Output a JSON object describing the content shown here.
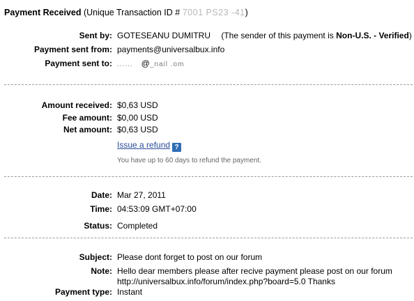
{
  "header": {
    "title": "Payment Received",
    "transaction_prefix": "(Unique Transaction ID #",
    "transaction_id_obscured": "   7001 PS23 -41",
    "transaction_suffix": ")"
  },
  "sender": {
    "sent_by_label": "Sent by:",
    "sent_by_name": "GOTESEANU DUMITRU",
    "sender_status_prefix": "(The sender of this payment is",
    "sender_status_value": "Non-U.S. - Verified",
    "sender_status_suffix": ")",
    "from_label": "Payment sent from:",
    "from_email": "payments@universalbux.info",
    "to_label": "Payment sent to:",
    "to_email_part1": "......",
    "to_email_at": "@",
    "to_email_part2": "_nail .om"
  },
  "amounts": {
    "received_label": "Amount received:",
    "received_value": "$0,63 USD",
    "fee_label": "Fee amount:",
    "fee_value": "$0,00 USD",
    "net_label": "Net amount:",
    "net_value": "$0,63 USD",
    "refund_link": "Issue a refund",
    "help_icon_glyph": "?",
    "refund_note": "You have up to 60 days to refund the payment."
  },
  "details": {
    "date_label": "Date:",
    "date_value": "Mar 27, 2011",
    "time_label": "Time:",
    "time_value": "04:53:09 GMT+07:00",
    "status_label": "Status:",
    "status_value": "Completed"
  },
  "message": {
    "subject_label": "Subject:",
    "subject_value": "Please dont forget to post on our forum",
    "note_label": "Note:",
    "note_line1": "Hello dear members please after recive payment please post on our forum",
    "note_line2": "http://universalbux.info/forum/index.php?board=5.0 Thanks",
    "payment_type_label": "Payment type:",
    "payment_type_value": "Instant"
  },
  "colors": {
    "link": "#2a4d9a",
    "help_icon_bg": "#2f6db5",
    "divider": "#9a9a9a",
    "note_text": "#666666"
  },
  "icons": {
    "help": "question-mark-icon"
  }
}
